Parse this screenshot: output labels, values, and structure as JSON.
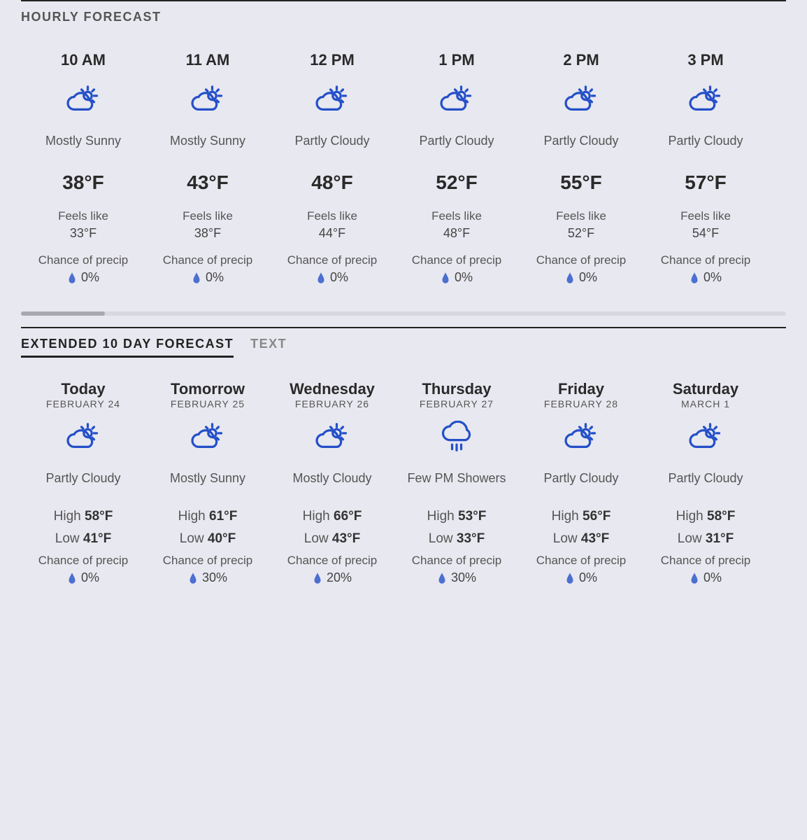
{
  "colors": {
    "icon_blue": "#2450c8"
  },
  "hourly": {
    "title": "HOURLY FORECAST",
    "feels_label": "Feels like",
    "precip_label": "Chance of precip",
    "items": [
      {
        "time": "10 AM",
        "icon": "partly-sunny",
        "cond": "Mostly Sunny",
        "temp": "38°F",
        "feels": "33°F",
        "precip": "0%"
      },
      {
        "time": "11 AM",
        "icon": "partly-sunny",
        "cond": "Mostly Sunny",
        "temp": "43°F",
        "feels": "38°F",
        "precip": "0%"
      },
      {
        "time": "12 PM",
        "icon": "partly-sunny",
        "cond": "Partly Cloudy",
        "temp": "48°F",
        "feels": "44°F",
        "precip": "0%"
      },
      {
        "time": "1 PM",
        "icon": "partly-sunny",
        "cond": "Partly Cloudy",
        "temp": "52°F",
        "feels": "48°F",
        "precip": "0%"
      },
      {
        "time": "2 PM",
        "icon": "partly-sunny",
        "cond": "Partly Cloudy",
        "temp": "55°F",
        "feels": "52°F",
        "precip": "0%"
      },
      {
        "time": "3 PM",
        "icon": "partly-sunny",
        "cond": "Partly Cloudy",
        "temp": "57°F",
        "feels": "54°F",
        "precip": "0%"
      }
    ]
  },
  "extended": {
    "tab_active": "EXTENDED 10 DAY FORECAST",
    "tab_inactive": "TEXT",
    "precip_label": "Chance of precip",
    "high_label": "High",
    "low_label": "Low",
    "items": [
      {
        "dayname": "Today",
        "date": "FEBRUARY 24",
        "icon": "partly-sunny",
        "cond": "Partly Cloudy",
        "high": "58°F",
        "low": "41°F",
        "precip": "0%"
      },
      {
        "dayname": "Tomorrow",
        "date": "FEBRUARY 25",
        "icon": "partly-sunny",
        "cond": "Mostly Sunny",
        "high": "61°F",
        "low": "40°F",
        "precip": "30%"
      },
      {
        "dayname": "Wednesday",
        "date": "FEBRUARY 26",
        "icon": "partly-sunny",
        "cond": "Mostly Cloudy",
        "high": "66°F",
        "low": "43°F",
        "precip": "20%"
      },
      {
        "dayname": "Thursday",
        "date": "FEBRUARY 27",
        "icon": "showers",
        "cond": "Few PM Showers",
        "high": "53°F",
        "low": "33°F",
        "precip": "30%"
      },
      {
        "dayname": "Friday",
        "date": "FEBRUARY 28",
        "icon": "partly-sunny",
        "cond": "Partly Cloudy",
        "high": "56°F",
        "low": "43°F",
        "precip": "0%"
      },
      {
        "dayname": "Saturday",
        "date": "MARCH 1",
        "icon": "partly-sunny",
        "cond": "Partly Cloudy",
        "high": "58°F",
        "low": "31°F",
        "precip": "0%"
      }
    ]
  }
}
